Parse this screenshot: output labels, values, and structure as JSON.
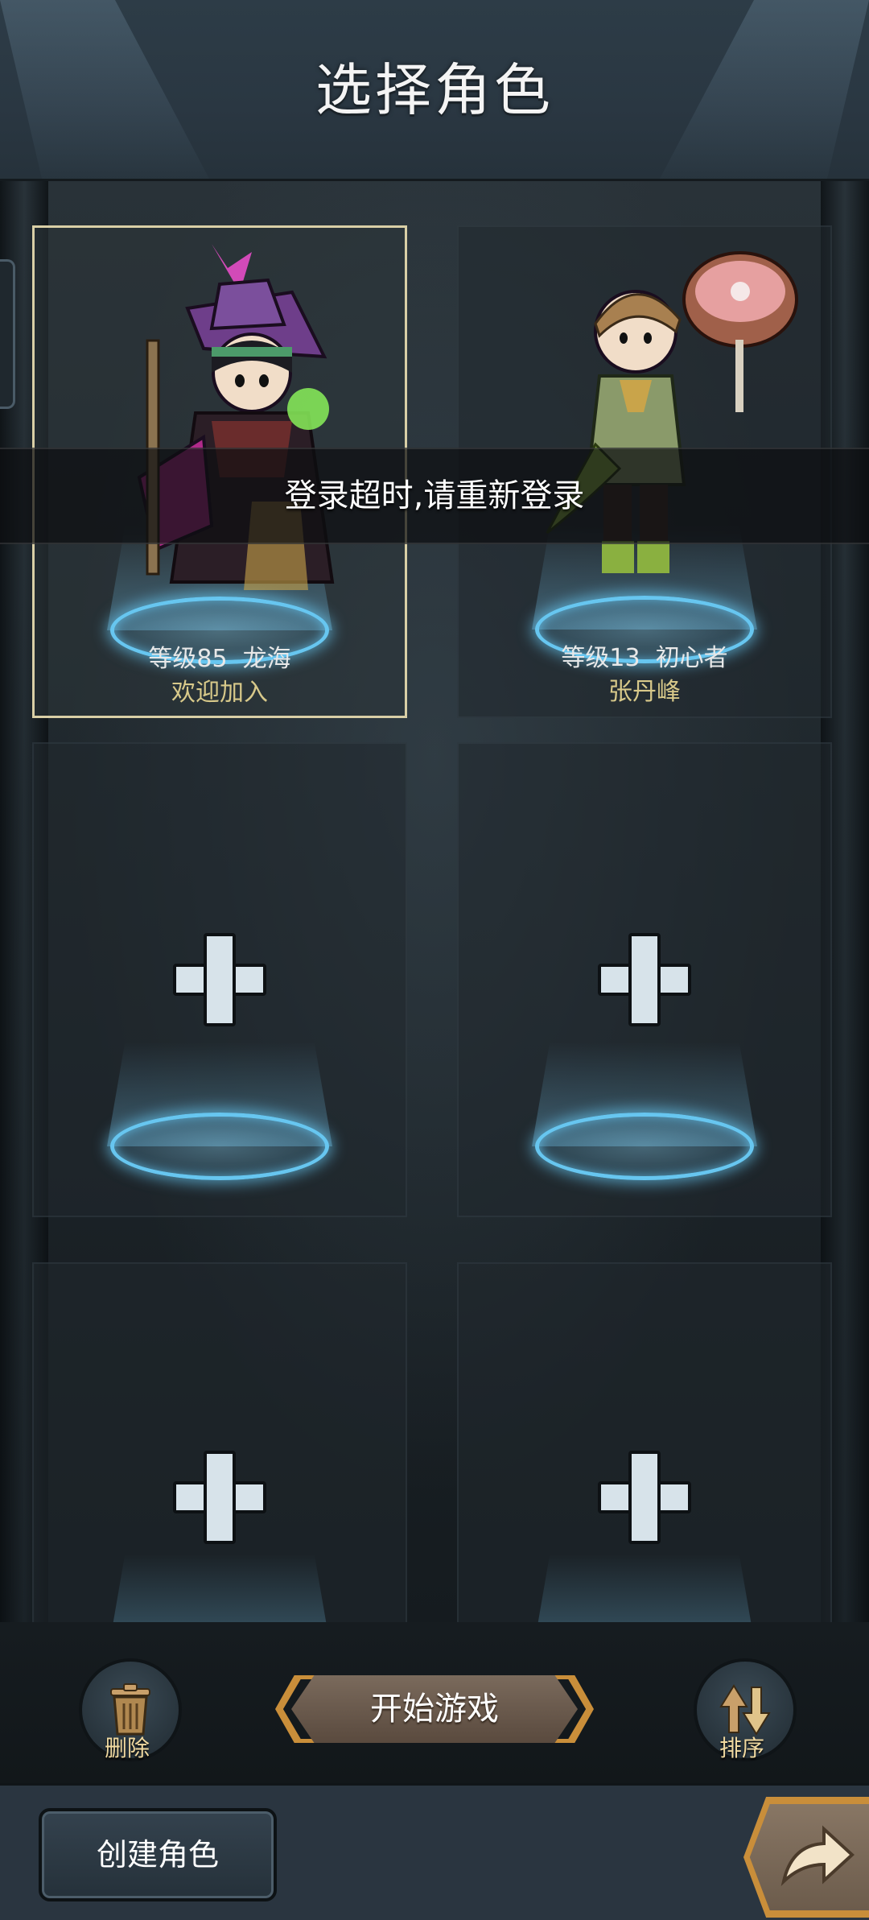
{
  "header": {
    "title": "选择角色"
  },
  "characters": [
    {
      "level": "等级85  龙海",
      "subtitle": "欢迎加入",
      "selected": true
    },
    {
      "level": "等级13  初心者",
      "subtitle": "张丹峰",
      "selected": false
    }
  ],
  "empty_slots": [
    "add-slot-1",
    "add-slot-2",
    "add-slot-3",
    "add-slot-4"
  ],
  "toast": {
    "message": "登录超时,请重新登录"
  },
  "actions": {
    "delete_label": "删除",
    "start_label": "开始游戏",
    "sort_label": "排序"
  },
  "footer": {
    "create_label": "创建角色"
  },
  "icons": {
    "delete": "trash-icon",
    "sort": "sort-arrows-icon",
    "add": "plus-icon",
    "enter": "arrow-right-icon"
  },
  "colors": {
    "selected_border": "#d9cfa6",
    "subtitle": "#d8c98a",
    "pad_glow": "#67c6f0",
    "button_rim": "#c98e3a"
  }
}
